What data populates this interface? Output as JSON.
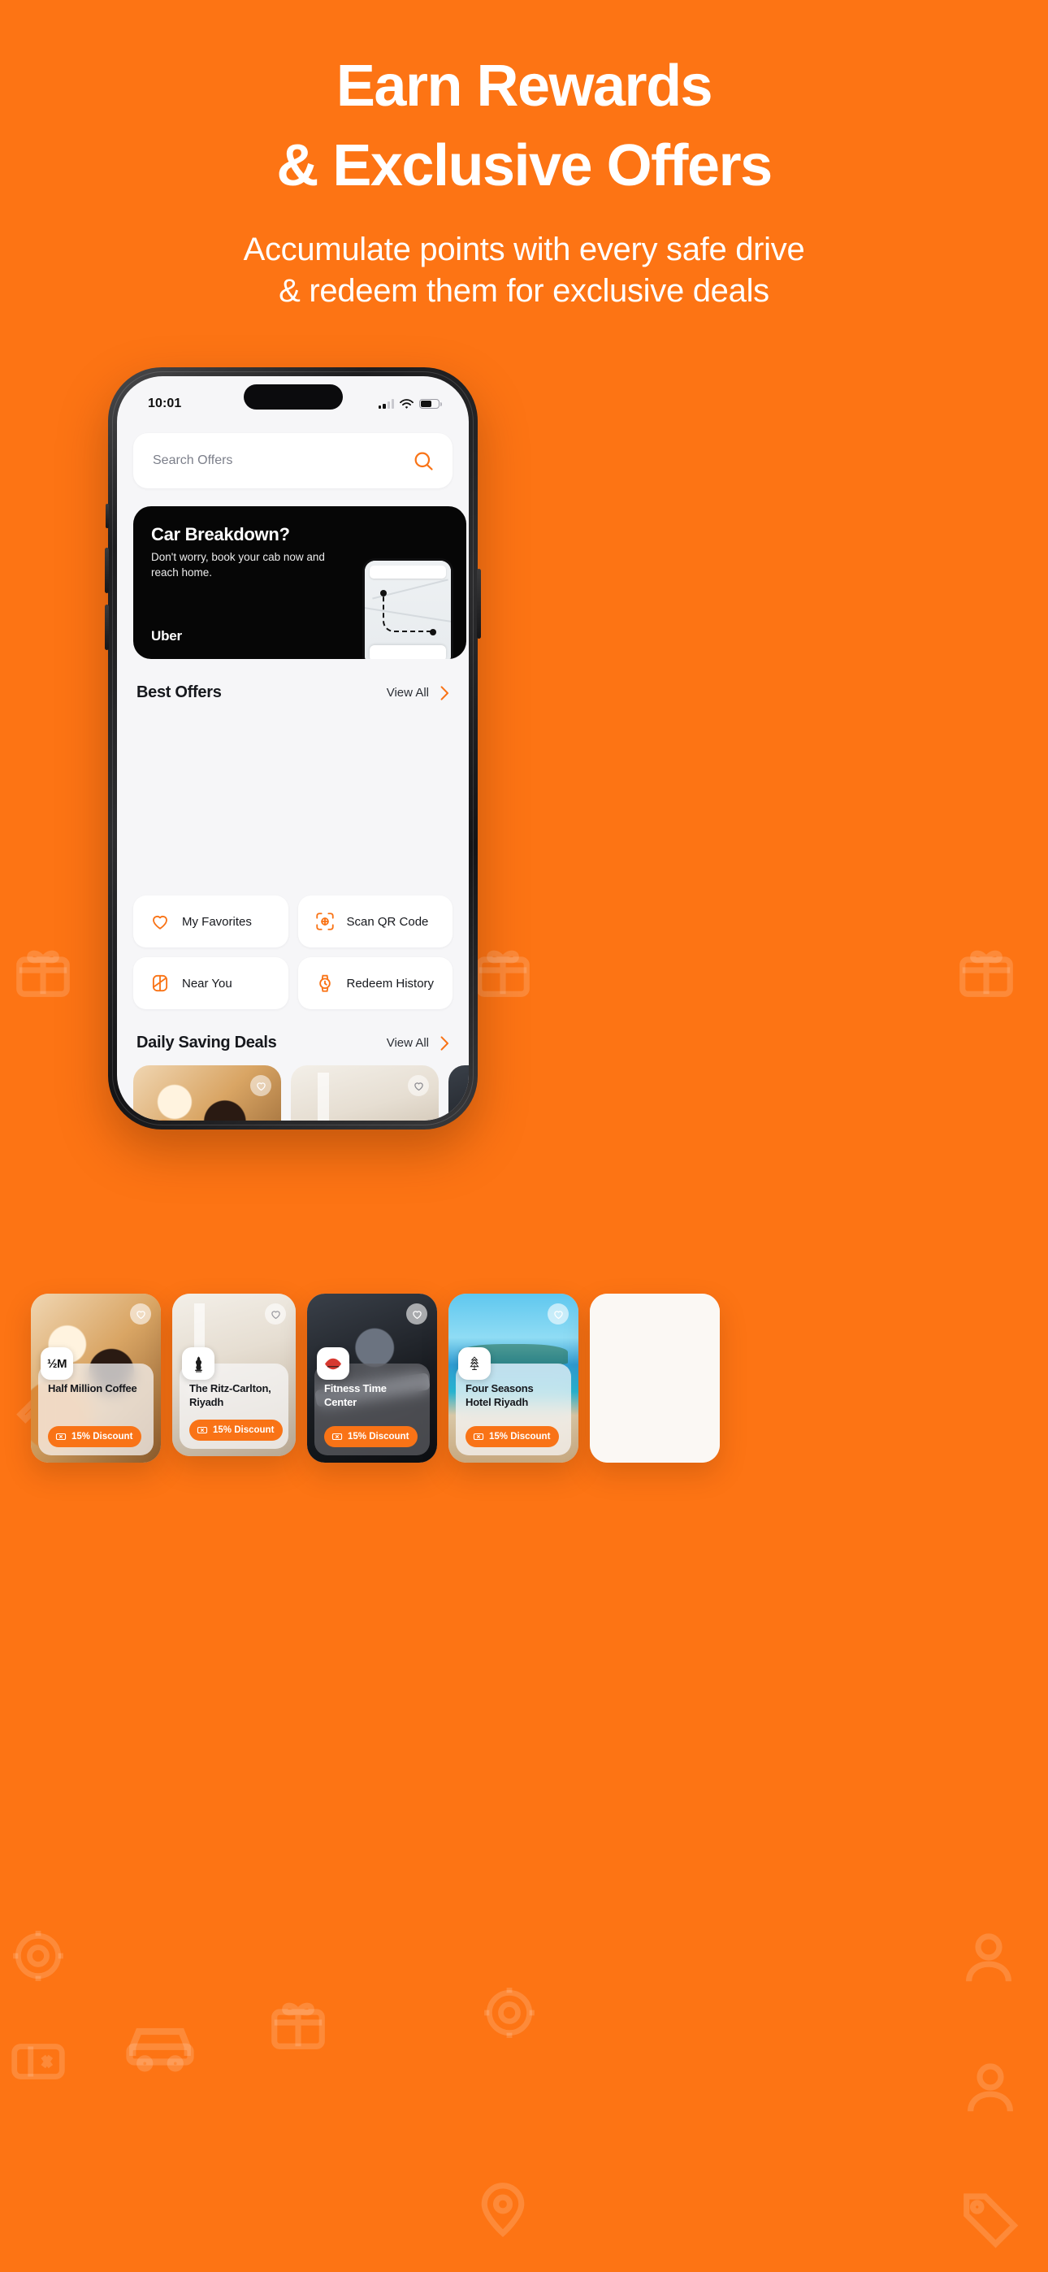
{
  "theme": {
    "background_orange": "#FD7414",
    "accent_orange": "#F97316",
    "dark": "#060606",
    "purple_peek": "#6D28D9"
  },
  "hero": {
    "title_line1": "Earn Rewards",
    "title_line2": "& Exclusive Offers",
    "subtitle_line1": "Accumulate points with every safe drive",
    "subtitle_line2": "& redeem them for exclusive deals"
  },
  "phone": {
    "statusbar": {
      "time": "10:01",
      "signal_icon": "cellular-signal-icon",
      "wifi_icon": "wifi-icon",
      "battery_icon": "battery-icon"
    },
    "search": {
      "placeholder": "Search Offers",
      "icon": "search-icon"
    },
    "banner": {
      "title": "Car Breakdown?",
      "body": "Don't worry, book your cab now and reach home.",
      "brand": "Uber"
    },
    "sections": {
      "best_offers": {
        "title": "Best Offers",
        "view_all": "View All",
        "chevron": "chevron-right-icon"
      },
      "daily_deals": {
        "title": "Daily Saving Deals",
        "view_all": "View All",
        "chevron": "chevron-right-icon"
      }
    },
    "offers": [
      {
        "name": "Half Million Coffee",
        "discount": "15% Discount",
        "logo_text": "½M",
        "logo_icon": "half-million-coffee-logo",
        "heart_icon": "heart-outline-icon",
        "badge_icon": "discount-ticket-icon",
        "style": "light"
      },
      {
        "name": "The Ritz-Carlton, Riyadh",
        "discount": "15% Discount",
        "logo_text": "",
        "logo_icon": "ritz-carlton-lion-logo",
        "heart_icon": "heart-outline-icon",
        "badge_icon": "discount-ticket-icon",
        "style": "light"
      },
      {
        "name": "Fitness Time Center",
        "discount": "15% Discount",
        "logo_text": "",
        "logo_icon": "fitness-time-logo",
        "heart_icon": "heart-outline-icon",
        "badge_icon": "discount-ticket-icon",
        "style": "dark"
      },
      {
        "name": "Four Seasons Hotel Riyadh",
        "discount": "15% Discount",
        "logo_text": "",
        "logo_icon": "four-seasons-tree-logo",
        "heart_icon": "heart-outline-icon",
        "badge_icon": "discount-ticket-icon",
        "style": "light"
      }
    ],
    "actions": [
      {
        "label": "My Favorites",
        "icon": "heart-icon"
      },
      {
        "label": "Scan QR Code",
        "icon": "qr-scan-icon"
      },
      {
        "label": "Near You",
        "icon": "map-location-icon"
      },
      {
        "label": "Redeem History",
        "icon": "history-clock-icon"
      }
    ],
    "daily_deals": [
      {
        "logo_icon": "half-million-coffee-logo",
        "heart_icon": "heart-outline-icon"
      },
      {
        "logo_icon": "ritz-carlton-lion-logo",
        "heart_icon": "heart-outline-icon"
      },
      {
        "logo_icon": "fitness-time-logo",
        "heart_icon": "heart-outline-icon"
      }
    ]
  }
}
